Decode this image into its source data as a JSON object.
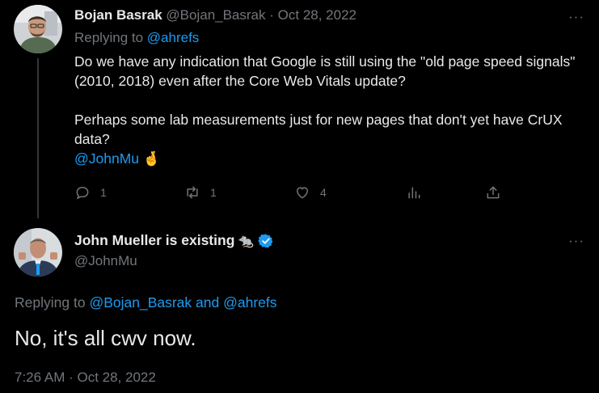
{
  "tweet1": {
    "author_name": "Bojan Basrak",
    "author_handle": "@Bojan_Basrak",
    "separator": "·",
    "date": "Oct 28, 2022",
    "replying_to_label": "Replying to",
    "replying_to": "@ahrefs",
    "paragraph1": "Do we have any indication that Google is still using the \"old page speed signals\" (2010, 2018) even after the Core Web Vitals update?",
    "paragraph2": "Perhaps some lab measurements just for new pages that don't yet have CrUX data?",
    "mention": "@JohnMu",
    "emoji": "🤞",
    "reply_count": "1",
    "retweet_count": "1",
    "like_count": "4",
    "more": "···"
  },
  "tweet2": {
    "author_name": "John Mueller is existing",
    "author_emoji": "🐀",
    "author_handle": "@JohnMu",
    "replying_to_label": "Replying to",
    "replying_to_1": "@Bojan_Basrak",
    "replying_to_and": "and",
    "replying_to_2": "@ahrefs",
    "text": "No, it's all cwv now.",
    "timestamp": "7:26 AM · Oct 28, 2022",
    "more": "···"
  },
  "icons": {
    "reply": "reply-icon",
    "retweet": "retweet-icon",
    "like": "heart-icon",
    "views": "analytics-icon",
    "share": "share-icon",
    "verified": "verified-badge-icon"
  },
  "colors": {
    "background": "#000000",
    "text": "#e7e9ea",
    "muted": "#71767b",
    "link": "#1d9bf0",
    "thread_line": "#333639"
  }
}
